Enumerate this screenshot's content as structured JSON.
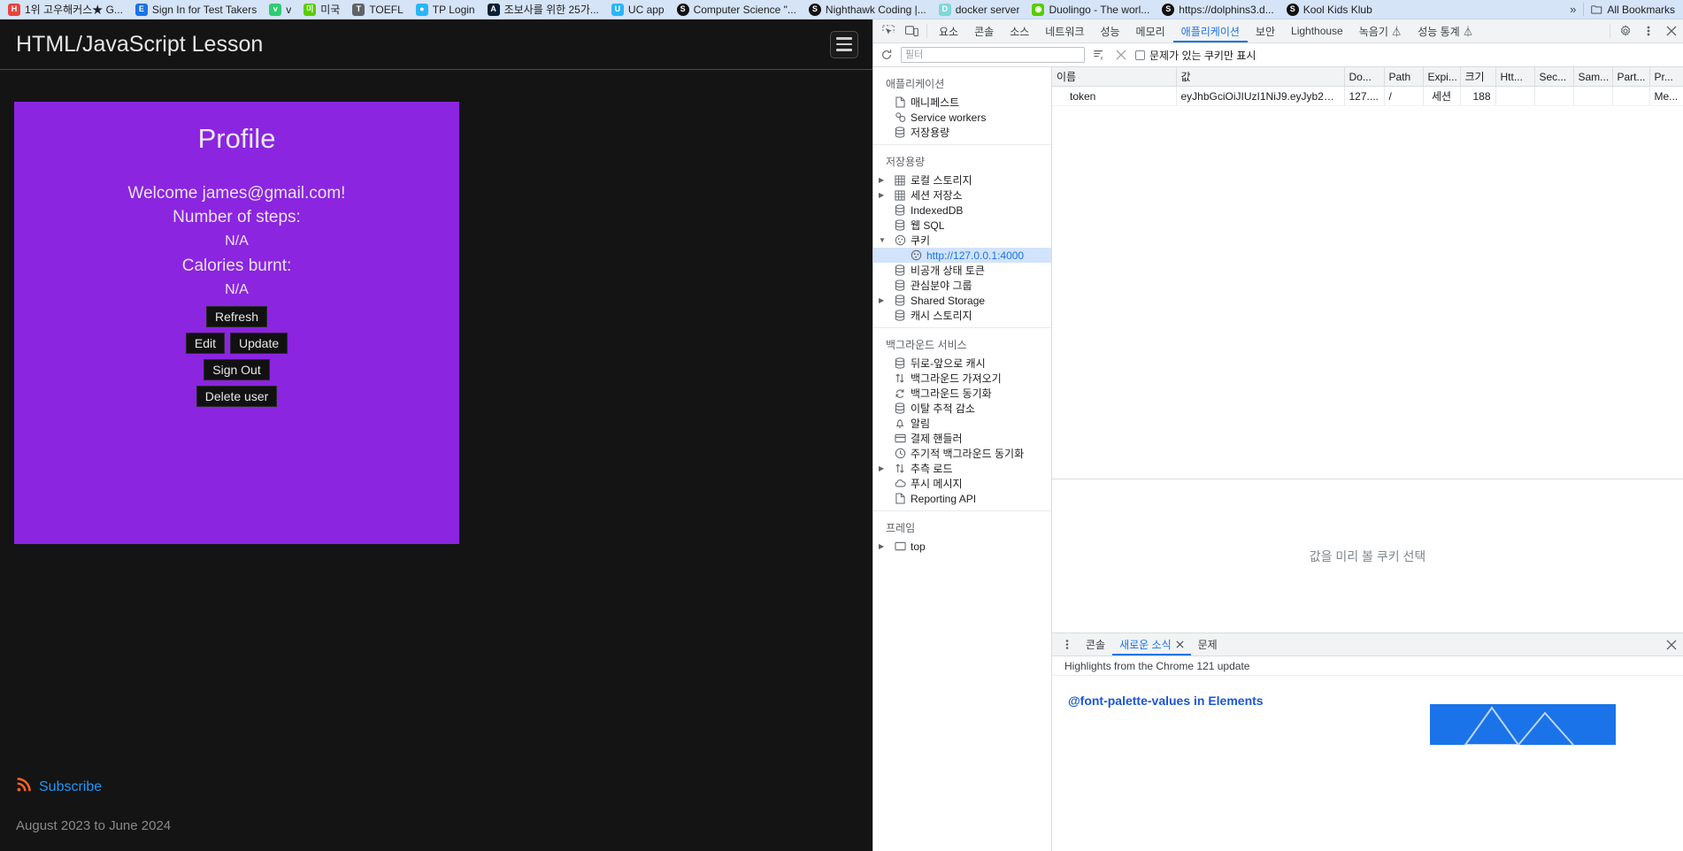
{
  "bookmarks": {
    "items": [
      {
        "label": "1위 고우해커스★ G...",
        "icon": "bookmark-favicon",
        "color": "fv-red"
      },
      {
        "label": "Sign In for Test Takers",
        "icon": "bookmark-favicon",
        "color": "fv-blue"
      },
      {
        "label": "v",
        "icon": "bookmark-favicon",
        "color": "fv-green"
      },
      {
        "label": "미국",
        "icon": "bookmark-favicon",
        "color": "fv-lgreen"
      },
      {
        "label": "TOEFL",
        "icon": "bookmark-favicon",
        "color": "fv-gray"
      },
      {
        "label": "TP Login",
        "icon": "bookmark-favicon",
        "color": "fv-cyan"
      },
      {
        "label": "조보사를 위한 25가...",
        "icon": "bookmark-favicon",
        "color": "fv-navy"
      },
      {
        "label": "UC app",
        "icon": "bookmark-favicon",
        "color": "fv-cyan"
      },
      {
        "label": "Computer Science \"...",
        "icon": "bookmark-favicon",
        "color": "fv-black"
      },
      {
        "label": "Nighthawk Coding |...",
        "icon": "bookmark-favicon",
        "color": "fv-black"
      },
      {
        "label": "docker server",
        "icon": "bookmark-favicon",
        "color": "fv-teal"
      },
      {
        "label": "Duolingo - The worl...",
        "icon": "bookmark-favicon",
        "color": "fv-lgreen"
      },
      {
        "label": "https://dolphins3.d...",
        "icon": "bookmark-favicon",
        "color": "fv-black"
      },
      {
        "label": "Kool Kids Klub",
        "icon": "bookmark-favicon",
        "color": "fv-black"
      }
    ],
    "overflow_label": "»",
    "all_bookmarks_label": "All Bookmarks"
  },
  "page": {
    "title": "HTML/JavaScript Lesson",
    "menu_toggle_name": "hamburger-menu",
    "profile": {
      "heading": "Profile",
      "welcome": "Welcome james@gmail.com!",
      "steps_label": "Number of steps:",
      "steps_value": "N/A",
      "calories_label": "Calories burnt:",
      "calories_value": "N/A",
      "buttons": {
        "refresh": "Refresh",
        "edit": "Edit",
        "update": "Update",
        "signout": "Sign Out",
        "delete": "Delete user"
      },
      "background_color": "#8b25e0"
    },
    "footer": {
      "subscribe": "Subscribe",
      "date_range": "August 2023 to June 2024"
    }
  },
  "devtools": {
    "tabs": [
      {
        "label": "요소",
        "active": false
      },
      {
        "label": "콘솔",
        "active": false
      },
      {
        "label": "소스",
        "active": false
      },
      {
        "label": "네트워크",
        "active": false
      },
      {
        "label": "성능",
        "active": false
      },
      {
        "label": "메모리",
        "active": false
      },
      {
        "label": "애플리케이션",
        "active": true
      },
      {
        "label": "보안",
        "active": false
      },
      {
        "label": "Lighthouse",
        "active": false
      },
      {
        "label": "녹음기 ⏃",
        "active": false
      },
      {
        "label": "성능 통계 ⏃",
        "active": false
      }
    ],
    "filter_bar": {
      "refresh_name": "refresh-cookies-button",
      "placeholder": "필터",
      "value": "",
      "clear_filtered_label": "clear-filtered-cookies",
      "clear_all_label": "clear-all-cookies",
      "only_problem_label": "문제가 있는 쿠키만 표시",
      "only_problem_checked": false
    },
    "sidebar": {
      "groups": [
        {
          "title": "애플리케이션",
          "items": [
            {
              "label": "매니페스트",
              "icon": "document-icon",
              "caret": "none",
              "indent": 1,
              "selected": false
            },
            {
              "label": "Service workers",
              "icon": "gears-icon",
              "caret": "none",
              "indent": 1,
              "selected": false
            },
            {
              "label": "저장용량",
              "icon": "database-icon",
              "caret": "none",
              "indent": 1,
              "selected": false
            }
          ]
        },
        {
          "title": "저장용량",
          "items": [
            {
              "label": "로컬 스토리지",
              "icon": "table-icon",
              "caret": "closed",
              "indent": 1,
              "selected": false
            },
            {
              "label": "세션 저장소",
              "icon": "table-icon",
              "caret": "closed",
              "indent": 1,
              "selected": false
            },
            {
              "label": "IndexedDB",
              "icon": "database-icon",
              "caret": "none",
              "indent": 1,
              "selected": false
            },
            {
              "label": "웹 SQL",
              "icon": "database-icon",
              "caret": "none",
              "indent": 1,
              "selected": false
            },
            {
              "label": "쿠키",
              "icon": "cookie-icon",
              "caret": "open",
              "indent": 1,
              "selected": false
            },
            {
              "label": "http://127.0.0.1:4000",
              "icon": "cookie-icon",
              "caret": "none",
              "indent": 2,
              "selected": true
            },
            {
              "label": "비공개 상태 토큰",
              "icon": "database-icon",
              "caret": "none",
              "indent": 1,
              "selected": false
            },
            {
              "label": "관심분야 그룹",
              "icon": "database-icon",
              "caret": "none",
              "indent": 1,
              "selected": false
            },
            {
              "label": "Shared Storage",
              "icon": "database-icon",
              "caret": "closed",
              "indent": 1,
              "selected": false
            },
            {
              "label": "캐시 스토리지",
              "icon": "database-icon",
              "caret": "none",
              "indent": 1,
              "selected": false
            }
          ]
        },
        {
          "title": "백그라운드 서비스",
          "items": [
            {
              "label": "뒤로-앞으로 캐시",
              "icon": "database-icon",
              "caret": "none",
              "indent": 1,
              "selected": false
            },
            {
              "label": "백그라운드 가져오기",
              "icon": "arrows-updown-icon",
              "caret": "none",
              "indent": 1,
              "selected": false
            },
            {
              "label": "백그라운드 동기화",
              "icon": "sync-icon",
              "caret": "none",
              "indent": 1,
              "selected": false
            },
            {
              "label": "이탈 추적 감소",
              "icon": "database-icon",
              "caret": "none",
              "indent": 1,
              "selected": false
            },
            {
              "label": "알림",
              "icon": "bell-icon",
              "caret": "none",
              "indent": 1,
              "selected": false
            },
            {
              "label": "결제 핸들러",
              "icon": "card-icon",
              "caret": "none",
              "indent": 1,
              "selected": false
            },
            {
              "label": "주기적 백그라운드 동기화",
              "icon": "clock-icon",
              "caret": "none",
              "indent": 1,
              "selected": false
            },
            {
              "label": "추측 로드",
              "icon": "arrows-updown-icon",
              "caret": "closed",
              "indent": 1,
              "selected": false
            },
            {
              "label": "푸시 메시지",
              "icon": "cloud-icon",
              "caret": "none",
              "indent": 1,
              "selected": false
            },
            {
              "label": "Reporting API",
              "icon": "document-icon",
              "caret": "none",
              "indent": 1,
              "selected": false
            }
          ]
        },
        {
          "title": "프레임",
          "items": [
            {
              "label": "top",
              "icon": "frame-icon",
              "caret": "closed",
              "indent": 1,
              "selected": false
            }
          ]
        }
      ]
    },
    "cookie_table": {
      "columns": [
        "이름",
        "값",
        "Do...",
        "Path",
        "Expi...",
        "크기",
        "Htt...",
        "Sec...",
        "Sam...",
        "Part...",
        "Pr..."
      ],
      "rows": [
        {
          "name": "token",
          "value": "eyJhbGciOiJIUzI1NiJ9.eyJyb2xlcyI6...",
          "domain": "127....",
          "path": "/",
          "expires": "세션",
          "size": "188",
          "http_only": "",
          "secure": "",
          "samesite": "",
          "partition": "",
          "priority": "Me..."
        }
      ],
      "preview_placeholder": "값을 미리 볼 쿠키 선택"
    },
    "drawer": {
      "tabs": [
        {
          "label": "콘솔",
          "active": false,
          "closable": false
        },
        {
          "label": "새로운 소식",
          "active": true,
          "closable": true
        },
        {
          "label": "문제",
          "active": false,
          "closable": false
        }
      ],
      "subtitle": "Highlights from the Chrome 121 update",
      "article_title": "@font-palette-values in Elements"
    }
  }
}
